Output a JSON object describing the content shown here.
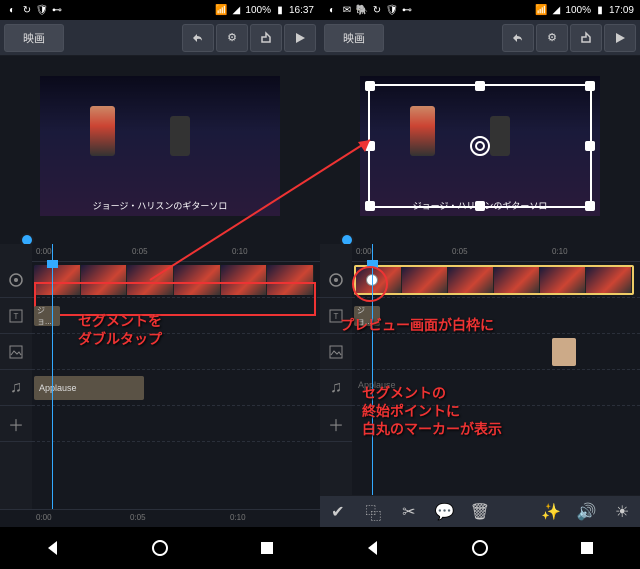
{
  "status": {
    "battery": "100%",
    "time_left": "16:37",
    "time_right": "17:09"
  },
  "toolbar": {
    "title": "映画"
  },
  "preview": {
    "caption": "ジョージ・ハリスンのギターソロ"
  },
  "timeline": {
    "ticks": [
      "0:00",
      "0:05",
      "0:10"
    ],
    "text_clip": "ジョ...",
    "audio_clip": "Applause"
  },
  "annotations": {
    "left1": "セグメントを",
    "left2": "ダブルタップ",
    "right1": "プレビュー画面が白枠に",
    "right2": "セグメントの",
    "right3": "終始ポイントに",
    "right4": "白丸のマーカーが表示"
  }
}
